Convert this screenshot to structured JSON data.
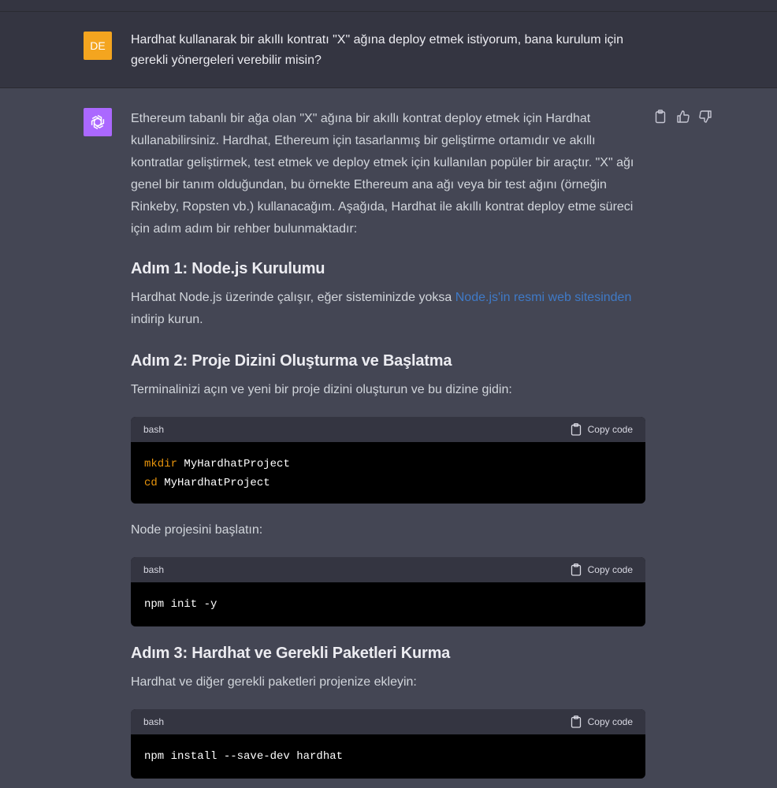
{
  "user": {
    "avatar_initials": "DE",
    "message": "Hardhat kullanarak bir akıllı kontratı \"X\" ağına deploy etmek istiyorum, bana kurulum için gerekli yönergeleri verebilir misin?"
  },
  "assistant": {
    "avatar_icon": "openai-logo-icon",
    "actions": [
      "clipboard-icon",
      "thumbs-up-icon",
      "thumbs-down-icon"
    ],
    "intro": "Ethereum tabanlı bir ağa olan \"X\" ağına bir akıllı kontrat deploy etmek için Hardhat kullanabilirsiniz. Hardhat, Ethereum için tasarlanmış bir geliştirme ortamıdır ve akıllı kontratlar geliştirmek, test etmek ve deploy etmek için kullanılan popüler bir araçtır. \"X\" ağı genel bir tanım olduğundan, bu örnekte Ethereum ana ağı veya bir test ağını (örneğin Rinkeby, Ropsten vb.) kullanacağım. Aşağıda, Hardhat ile akıllı kontrat deploy etme süreci için adım adım bir rehber bulunmaktadır:",
    "step1": {
      "heading": "Adım 1: Node.js Kurulumu",
      "text_before": "Hardhat Node.js üzerinde çalışır, eğer sisteminizde yoksa ",
      "link": "Node.js'in resmi web sitesinden",
      "text_after": " indirip kurun."
    },
    "step2": {
      "heading": "Adım 2: Proje Dizini Oluşturma ve Başlatma",
      "text1": "Terminalinizi açın ve yeni bir proje dizini oluşturun ve bu dizine gidin:",
      "code1": {
        "lang": "bash",
        "copy_label": "Copy code",
        "lines": [
          {
            "cmd": "mkdir",
            "arg": " MyHardhatProject"
          },
          {
            "cmd": "cd",
            "arg": " MyHardhatProject"
          }
        ]
      },
      "text2": "Node projesini başlatın:",
      "code2": {
        "lang": "bash",
        "copy_label": "Copy code",
        "line": "npm init -y"
      }
    },
    "step3": {
      "heading": "Adım 3: Hardhat ve Gerekli Paketleri Kurma",
      "text1": "Hardhat ve diğer gerekli paketleri projenize ekleyin:",
      "code1": {
        "lang": "bash",
        "copy_label": "Copy code",
        "line": "npm install --save-dev hardhat"
      }
    }
  },
  "colors": {
    "user_bg": "#343541",
    "assistant_bg": "#444654",
    "user_avatar": "#f4a51f",
    "bot_avatar": "#ab68ff",
    "link": "#3f7ac7",
    "keyword": "#e9950c"
  }
}
